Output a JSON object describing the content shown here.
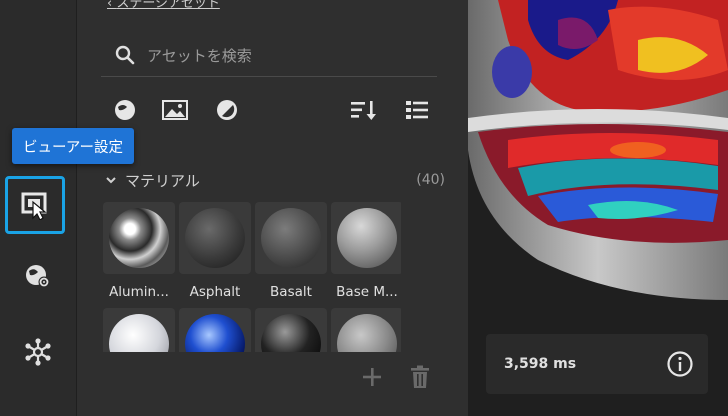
{
  "panel": {
    "back_link": "ステージアセット",
    "search": {
      "placeholder": "アセットを検索"
    },
    "section": {
      "title": "マテリアル",
      "count": "(40)"
    },
    "tiles": [
      {
        "label": "Alumin..."
      },
      {
        "label": "Asphalt"
      },
      {
        "label": "Basalt"
      },
      {
        "label": "Base M..."
      },
      {
        "label": ""
      },
      {
        "label": ""
      },
      {
        "label": ""
      },
      {
        "label": ""
      }
    ]
  },
  "tooltip": {
    "text": "ビューアー設定"
  },
  "viewport": {
    "render_time": "3,598 ms"
  },
  "icons": {
    "rail": [
      "viewer-settings-icon",
      "environment-icon",
      "scene-graph-icon"
    ],
    "toolbar": [
      "materials-filter-icon",
      "images-filter-icon",
      "lights-filter-icon",
      "sort-icon",
      "list-view-icon"
    ],
    "footer": [
      "add-icon",
      "trash-icon"
    ]
  },
  "colors": {
    "accent": "#1aa3e6",
    "tooltip": "#1f74d6",
    "panel": "#2f2f2f",
    "rail": "#2b2b2b"
  }
}
